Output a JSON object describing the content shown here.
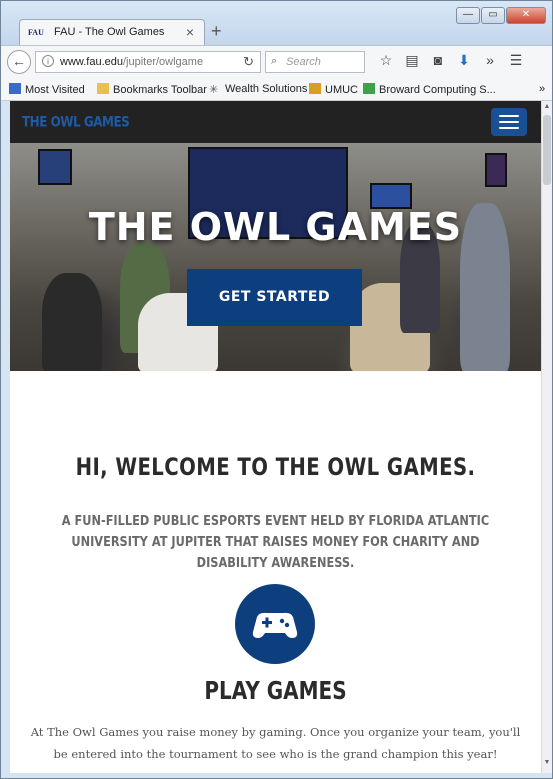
{
  "browser": {
    "tab_title": "FAU - The Owl Games",
    "tab_favicon_text": "FAU",
    "url_host": "www.fau.edu",
    "url_path": "/jupiter/owlgame",
    "search_placeholder": "Search",
    "icons": [
      "back-icon",
      "info-icon",
      "reload-icon",
      "search-icon",
      "bookmark-star-icon",
      "reading-list-icon",
      "pocket-icon",
      "download-icon",
      "overflow-icon",
      "menu-icon"
    ]
  },
  "bookmarks": [
    {
      "label": "Most Visited",
      "icon": "most-visited-icon",
      "color": "#3a6bc6"
    },
    {
      "label": "Bookmarks Toolbar",
      "icon": "folder-icon",
      "color": "#e9c14a"
    },
    {
      "label": "Wealth Solutions",
      "icon": "star-burst-icon",
      "color": "#555555"
    },
    {
      "label": "UMUC",
      "icon": "umuc-icon",
      "color": "#d8a020"
    },
    {
      "label": "Broward Computing S...",
      "icon": "broward-icon",
      "color": "#3fa14a"
    }
  ],
  "site": {
    "brand": "THE OWL GAMES",
    "hero_title": "THE OWL GAMES",
    "cta_label": "GET STARTED",
    "welcome_heading": "HI, WELCOME TO THE OWL GAMES.",
    "tagline": "A FUN-FILLED PUBLIC ESPORTS EVENT HELD BY FLORIDA ATLANTIC UNIVERSITY AT JUPITER THAT RAISES MONEY FOR CHARITY AND DISABILITY AWARENESS.",
    "section_icon": "gamepad-icon",
    "section_title": "PLAY GAMES",
    "section_text": "At The Owl Games you raise money by gaming. Once you organize your team, you'll be entered into the tournament to see who is the grand champion this year!"
  },
  "colors": {
    "brand_blue": "#0d3f7e",
    "nav_dark": "#222222"
  }
}
